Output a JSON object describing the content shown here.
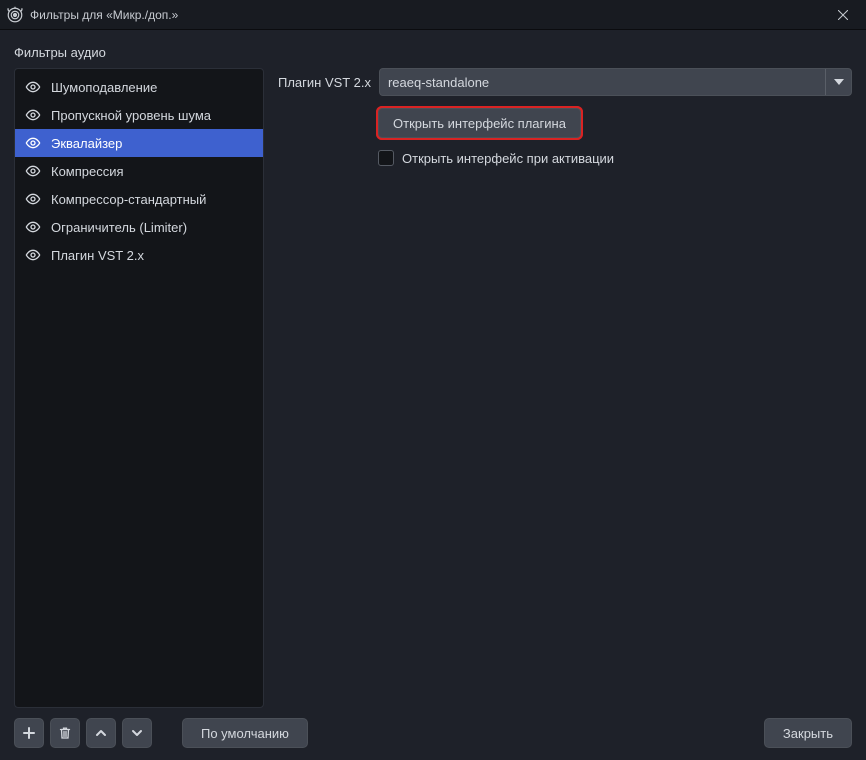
{
  "window": {
    "title": "Фильтры для «Микр./доп.»"
  },
  "section_label": "Фильтры аудио",
  "filters": {
    "items": [
      {
        "label": "Шумоподавление",
        "selected": false
      },
      {
        "label": "Пропускной уровень шума",
        "selected": false
      },
      {
        "label": "Эквалайзер",
        "selected": true
      },
      {
        "label": "Компрессия",
        "selected": false
      },
      {
        "label": "Компрессор-стандартный",
        "selected": false
      },
      {
        "label": "Ограничитель (Limiter)",
        "selected": false
      },
      {
        "label": "Плагин VST 2.x",
        "selected": false
      }
    ]
  },
  "properties": {
    "plugin_label": "Плагин VST 2.x",
    "plugin_value": "reaeq-standalone",
    "open_interface_btn": "Открыть интерфейс плагина",
    "open_on_activate_label": "Открыть интерфейс при активации",
    "open_on_activate_checked": false
  },
  "footer": {
    "defaults_btn": "По умолчанию",
    "close_btn": "Закрыть"
  }
}
